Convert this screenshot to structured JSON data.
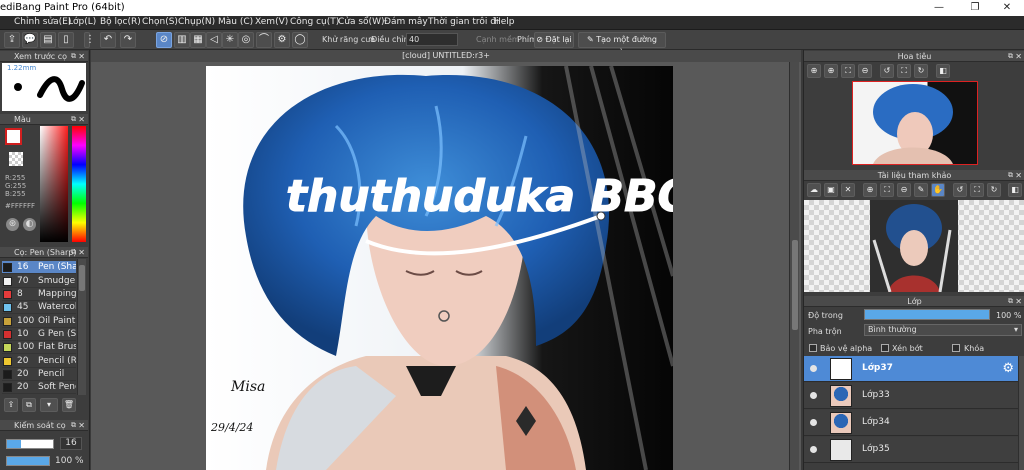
{
  "window": {
    "title": "ediBang Paint Pro (64bit)",
    "min": "—",
    "max": "❐",
    "close": "✕"
  },
  "menu": [
    "Chỉnh sửa(E)",
    "Lớp(L)",
    "Bộ lọc(R)",
    "Chọn(S)",
    "Chụp(N)",
    "Màu (C)",
    "Xem(V)",
    "Công cụ(T)",
    "Cửa sổ(W)",
    "Đám mây",
    "Thời gian trôi đi",
    "Help"
  ],
  "toolbar": {
    "antialias_label": "Khử răng cưa",
    "adjust_label": "Điều chỉnh",
    "adjust_value": "40",
    "edge_label": "Cạnh mềm",
    "phim_label": "Phím",
    "reset_label": "Đặt lại",
    "straight_label": "Tạo một đường thẳng"
  },
  "left": {
    "preview_title": "Xem trước cọ",
    "preview_size": "1.22mm",
    "color_title": "Màu",
    "rgb": [
      "R:255",
      "G:255",
      "B:255"
    ],
    "hex": "#FFFFFF",
    "brush_title": "Cọ: Pen (Sharp)",
    "brushes": [
      {
        "size": "16",
        "name": "Pen (Sharp)",
        "color": "#1b1b1b"
      },
      {
        "size": "70",
        "name": "Smudge",
        "color": "#f2f2f2"
      },
      {
        "size": "8",
        "name": "Mapping",
        "color": "#e53b3b"
      },
      {
        "size": "45",
        "name": "Watercolor",
        "color": "#6fc2ee"
      },
      {
        "size": "100",
        "name": "Oil Paint",
        "color": "#c9a23a"
      },
      {
        "size": "10",
        "name": "G Pen (Soft)",
        "color": "#d43030"
      },
      {
        "size": "100",
        "name": "Flat Brush",
        "color": "#c6d85a"
      },
      {
        "size": "20",
        "name": "Pencil (Rough)",
        "color": "#f0c830"
      },
      {
        "size": "20",
        "name": "Pencil",
        "color": "#1b1b1b"
      },
      {
        "size": "20",
        "name": "Soft Pencil",
        "color": "#1b1b1b"
      }
    ],
    "control_title": "Kiểm soát cọ",
    "control_size": "16",
    "control_opacity": "100 %"
  },
  "canvas": {
    "tab": "[cloud] UNTITLED:r3+",
    "signature": "Misa",
    "date": "29/4/24",
    "watermark": "thuthuduka BBQHD"
  },
  "right": {
    "navigator_title": "Hoa tiêu",
    "reference_title": "Tài liệu tham khảo",
    "layer_title": "Lớp",
    "opacity_label": "Độ trong",
    "opacity_value": "100 %",
    "blend_label": "Pha trộn",
    "blend_value": "Bình thường",
    "protect_alpha": "Bảo vệ alpha",
    "clipping": "Xén bớt",
    "lock": "Khóa",
    "layers": [
      "Lớp37",
      "Lớp33",
      "Lớp34",
      "Lớp35"
    ]
  },
  "colors": {
    "accent": "#4e8ad6",
    "canvas_bg": "#595959"
  }
}
